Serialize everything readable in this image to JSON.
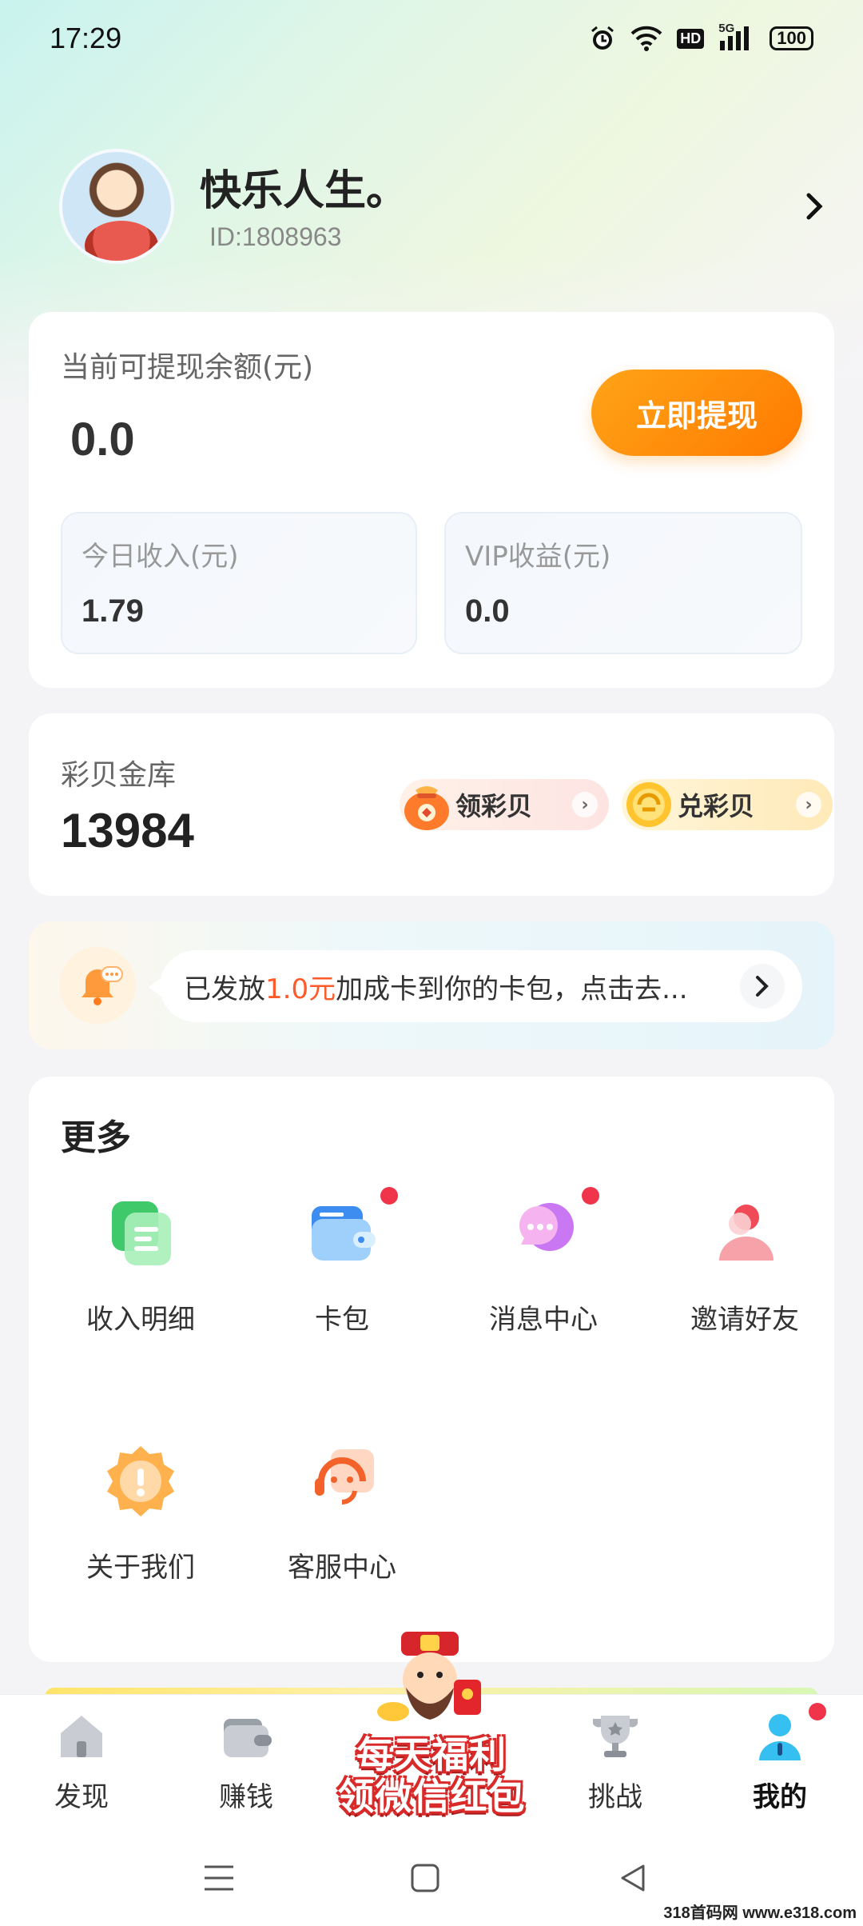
{
  "status_bar": {
    "time": "17:29",
    "network": "5G",
    "hd": "HD",
    "battery": "100"
  },
  "profile": {
    "nickname": "快乐人生。",
    "user_id": "ID:1808963"
  },
  "balance": {
    "label": "当前可提现余额(元)",
    "value": "0.0",
    "withdraw_button": "立即提现",
    "today_income_label": "今日收入(元)",
    "today_income_value": "1.79",
    "vip_income_label": "VIP收益(元)",
    "vip_income_value": "0.0"
  },
  "gold": {
    "label": "彩贝金库",
    "value": "13984",
    "get_button": "领彩贝",
    "exchange_button": "兑彩贝"
  },
  "notice": {
    "prefix": "已发放",
    "amount": "1.0元",
    "suffix": "加成卡到你的卡包，点击去..."
  },
  "more": {
    "title": "更多",
    "items": [
      {
        "label": "收入明细",
        "icon": "income-detail-icon",
        "badge": false
      },
      {
        "label": "卡包",
        "icon": "wallet-card-icon",
        "badge": true
      },
      {
        "label": "消息中心",
        "icon": "message-icon",
        "badge": true
      },
      {
        "label": "邀请好友",
        "icon": "invite-friend-icon",
        "badge": false
      },
      {
        "label": "关于我们",
        "icon": "about-icon",
        "badge": false
      },
      {
        "label": "客服中心",
        "icon": "customer-service-icon",
        "badge": false
      }
    ]
  },
  "promo": {
    "line1": "每天福利",
    "line2": "领微信红包"
  },
  "tabs": [
    {
      "label": "发现",
      "icon": "home-icon",
      "active": false
    },
    {
      "label": "赚钱",
      "icon": "wallet-icon",
      "active": false
    },
    {
      "label": "挑战",
      "icon": "trophy-icon",
      "active": false
    },
    {
      "label": "我的",
      "icon": "profile-icon",
      "active": true
    }
  ],
  "watermark": "318首码网 www.e318.com",
  "colors": {
    "accent_orange": "#ff8a00",
    "badge_red": "#f0354a",
    "highlight_text": "#ff5a2a"
  }
}
